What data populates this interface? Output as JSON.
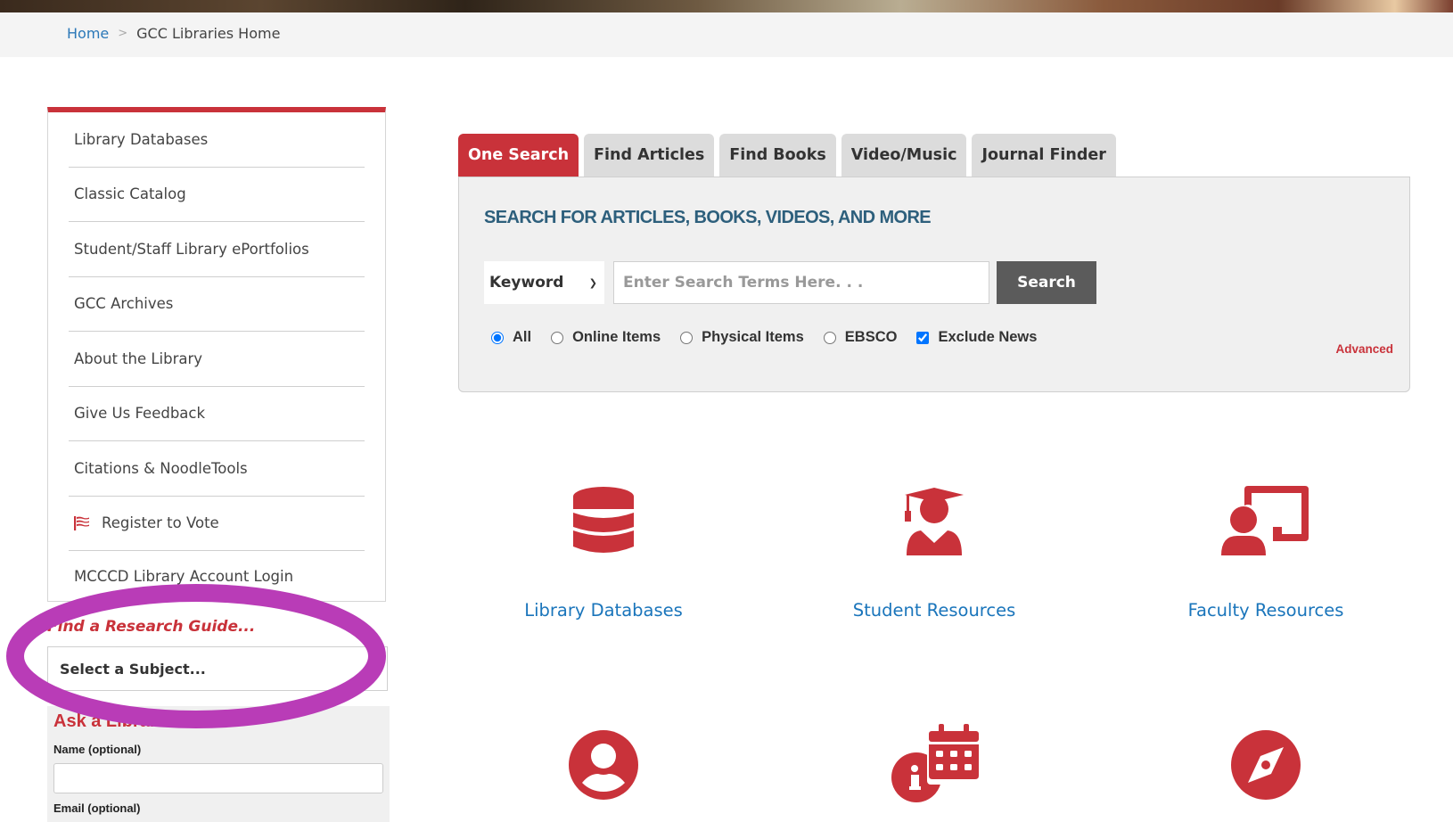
{
  "breadcrumb": {
    "items": [
      {
        "label": "Home",
        "link": true
      },
      {
        "label": "GCC Libraries Home",
        "link": false
      }
    ],
    "separator": ">"
  },
  "sidebar": {
    "items": [
      {
        "label": "Library Databases",
        "icon": null
      },
      {
        "label": "Classic Catalog",
        "icon": null
      },
      {
        "label": "Student/Staff Library ePortfolios",
        "icon": null
      },
      {
        "label": "GCC Archives",
        "icon": null
      },
      {
        "label": "About the Library",
        "icon": null
      },
      {
        "label": "Give Us Feedback",
        "icon": null
      },
      {
        "label": "Citations & NoodleTools",
        "icon": null
      },
      {
        "label": "Register to Vote",
        "icon": "flag-icon"
      },
      {
        "label": "MCCCD Library Account Login",
        "icon": null
      }
    ],
    "research_guide": {
      "label": "Find a Research Guide...",
      "select_value": "Select a Subject..."
    },
    "ask_librarian": {
      "title": "Ask a Librarian",
      "name_label": "Name (optional)",
      "name_value": "",
      "email_label": "Email (optional)"
    }
  },
  "search": {
    "tabs": [
      {
        "label": "One Search",
        "active": true
      },
      {
        "label": "Find Articles",
        "active": false
      },
      {
        "label": "Find Books",
        "active": false
      },
      {
        "label": "Video/Music",
        "active": false
      },
      {
        "label": "Journal Finder",
        "active": false
      }
    ],
    "heading": "SEARCH FOR ARTICLES, BOOKS, VIDEOS, AND MORE",
    "type_select": "Keyword",
    "input_value": "",
    "input_placeholder": "Enter Search Terms Here. . .",
    "button_label": "Search",
    "filters": [
      {
        "label": "All",
        "type": "radio",
        "checked": true
      },
      {
        "label": "Online Items",
        "type": "radio",
        "checked": false
      },
      {
        "label": "Physical Items",
        "type": "radio",
        "checked": false
      },
      {
        "label": "EBSCO",
        "type": "radio",
        "checked": false
      },
      {
        "label": "Exclude News",
        "type": "checkbox",
        "checked": true
      }
    ],
    "advanced_label": "Advanced"
  },
  "resources": [
    {
      "label": "Library Databases",
      "icon": "database-icon"
    },
    {
      "label": "Student Resources",
      "icon": "graduate-icon"
    },
    {
      "label": "Faculty Resources",
      "icon": "teacher-icon"
    },
    {
      "label": "",
      "icon": "user-circle-icon"
    },
    {
      "label": "",
      "icon": "calendar-info-icon"
    },
    {
      "label": "",
      "icon": "compass-icon"
    }
  ],
  "colors": {
    "accent_red": "#c9323a",
    "link_blue": "#1a75bb",
    "heading_blue": "#2d5f7c",
    "annotation_purple": "#b93cb7"
  }
}
